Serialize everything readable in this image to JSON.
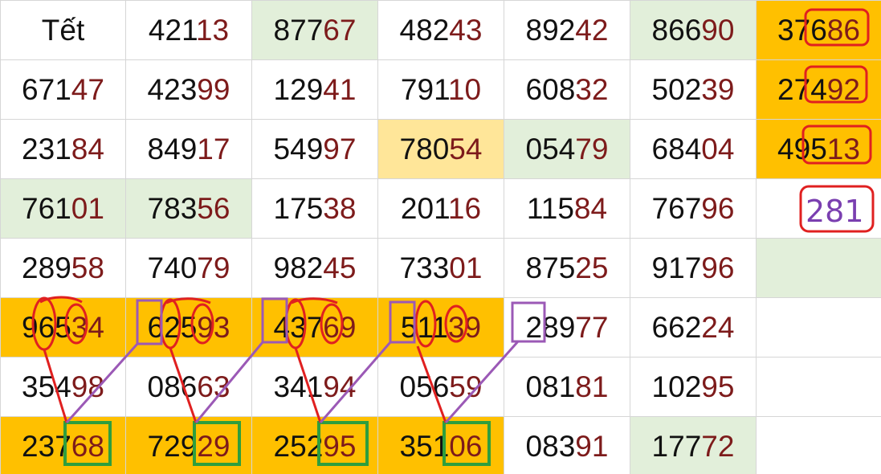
{
  "colors": {
    "orange": "#ffc000",
    "green": "#e2efda",
    "yellow": "#ffe699",
    "white": "#ffffff",
    "tail_digits": "#7d1b1b",
    "mark_red": "#e02020",
    "mark_purple": "#9b59b6",
    "mark_green": "#2e9e3e"
  },
  "rows": [
    [
      {
        "head": "Tết",
        "tail": "",
        "bg": "white"
      },
      {
        "head": "421",
        "tail": "13",
        "bg": "white"
      },
      {
        "head": "877",
        "tail": "67",
        "bg": "green"
      },
      {
        "head": "482",
        "tail": "43",
        "bg": "white"
      },
      {
        "head": "892",
        "tail": "42",
        "bg": "white"
      },
      {
        "head": "866",
        "tail": "90",
        "bg": "green"
      },
      {
        "head": "376",
        "tail": "86",
        "bg": "orange"
      }
    ],
    [
      {
        "head": "671",
        "tail": "47",
        "bg": "white"
      },
      {
        "head": "423",
        "tail": "99",
        "bg": "white"
      },
      {
        "head": "129",
        "tail": "41",
        "bg": "white"
      },
      {
        "head": "791",
        "tail": "10",
        "bg": "white"
      },
      {
        "head": "608",
        "tail": "32",
        "bg": "white"
      },
      {
        "head": "502",
        "tail": "39",
        "bg": "white"
      },
      {
        "head": "274",
        "tail": "92",
        "bg": "orange"
      }
    ],
    [
      {
        "head": "231",
        "tail": "84",
        "bg": "white"
      },
      {
        "head": "849",
        "tail": "17",
        "bg": "white"
      },
      {
        "head": "549",
        "tail": "97",
        "bg": "white"
      },
      {
        "head": "780",
        "tail": "54",
        "bg": "yellow"
      },
      {
        "head": "054",
        "tail": "79",
        "bg": "green"
      },
      {
        "head": "684",
        "tail": "04",
        "bg": "white"
      },
      {
        "head": "495",
        "tail": "13",
        "bg": "orange"
      }
    ],
    [
      {
        "head": "761",
        "tail": "01",
        "bg": "green"
      },
      {
        "head": "783",
        "tail": "56",
        "bg": "green"
      },
      {
        "head": "175",
        "tail": "38",
        "bg": "white"
      },
      {
        "head": "201",
        "tail": "16",
        "bg": "white"
      },
      {
        "head": "115",
        "tail": "84",
        "bg": "white"
      },
      {
        "head": "767",
        "tail": "96",
        "bg": "white"
      },
      {
        "head": "",
        "tail": "",
        "bg": "white"
      }
    ],
    [
      {
        "head": "289",
        "tail": "58",
        "bg": "white"
      },
      {
        "head": "740",
        "tail": "79",
        "bg": "white"
      },
      {
        "head": "982",
        "tail": "45",
        "bg": "white"
      },
      {
        "head": "733",
        "tail": "01",
        "bg": "white"
      },
      {
        "head": "875",
        "tail": "25",
        "bg": "white"
      },
      {
        "head": "917",
        "tail": "96",
        "bg": "white"
      },
      {
        "head": "",
        "tail": "",
        "bg": "green"
      }
    ],
    [
      {
        "head": "965",
        "tail": "34",
        "bg": "orange"
      },
      {
        "head": "625",
        "tail": "93",
        "bg": "orange"
      },
      {
        "head": "437",
        "tail": "69",
        "bg": "orange"
      },
      {
        "head": "511",
        "tail": "39",
        "bg": "orange"
      },
      {
        "head": "289",
        "tail": "77",
        "bg": "white"
      },
      {
        "head": "662",
        "tail": "24",
        "bg": "white"
      },
      {
        "head": "",
        "tail": "",
        "bg": "white"
      }
    ],
    [
      {
        "head": "354",
        "tail": "98",
        "bg": "white"
      },
      {
        "head": "086",
        "tail": "63",
        "bg": "white"
      },
      {
        "head": "341",
        "tail": "94",
        "bg": "white"
      },
      {
        "head": "056",
        "tail": "59",
        "bg": "white"
      },
      {
        "head": "081",
        "tail": "81",
        "bg": "white"
      },
      {
        "head": "102",
        "tail": "95",
        "bg": "white"
      },
      {
        "head": "",
        "tail": "",
        "bg": "white"
      }
    ],
    [
      {
        "head": "237",
        "tail": "68",
        "bg": "orange"
      },
      {
        "head": "729",
        "tail": "29",
        "bg": "orange"
      },
      {
        "head": "252",
        "tail": "95",
        "bg": "orange"
      },
      {
        "head": "351",
        "tail": "06",
        "bg": "orange"
      },
      {
        "head": "083",
        "tail": "91",
        "bg": "white"
      },
      {
        "head": "177",
        "tail": "72",
        "bg": "green"
      },
      {
        "head": "",
        "tail": "",
        "bg": "white"
      }
    ]
  ],
  "handwritten_note": "281"
}
